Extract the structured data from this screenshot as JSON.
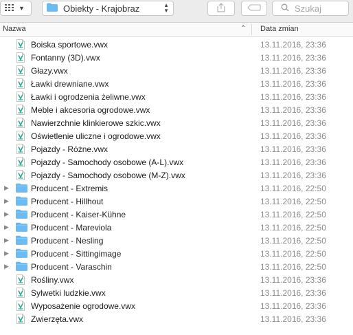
{
  "toolbar": {
    "path_label": "Obiekty - Krajobraz",
    "search_placeholder": "Szukaj"
  },
  "header": {
    "name_label": "Nazwa",
    "date_label": "Data zmian"
  },
  "colors": {
    "folder": "#6cbcf2",
    "file_icon": "#2aa892"
  },
  "rows": [
    {
      "name": "Boiska sportowe.vwx",
      "date": "13.11.2016, 23:36",
      "kind": "file"
    },
    {
      "name": "Fontanny (3D).vwx",
      "date": "13.11.2016, 23:36",
      "kind": "file"
    },
    {
      "name": "Głazy.vwx",
      "date": "13.11.2016, 23:36",
      "kind": "file"
    },
    {
      "name": "Ławki drewniane.vwx",
      "date": "13.11.2016, 23:36",
      "kind": "file"
    },
    {
      "name": "Ławki i ogrodzenia żeliwne.vwx",
      "date": "13.11.2016, 23:36",
      "kind": "file"
    },
    {
      "name": "Meble i akcesoria ogrodowe.vwx",
      "date": "13.11.2016, 23:36",
      "kind": "file"
    },
    {
      "name": "Nawierzchnie klinkierowe szkic.vwx",
      "date": "13.11.2016, 23:36",
      "kind": "file"
    },
    {
      "name": "Oświetlenie uliczne i ogrodowe.vwx",
      "date": "13.11.2016, 23:36",
      "kind": "file"
    },
    {
      "name": "Pojazdy - Różne.vwx",
      "date": "13.11.2016, 23:36",
      "kind": "file"
    },
    {
      "name": "Pojazdy - Samochody osobowe (A-L).vwx",
      "date": "13.11.2016, 23:36",
      "kind": "file"
    },
    {
      "name": "Pojazdy - Samochody osobowe (M-Z).vwx",
      "date": "13.11.2016, 23:36",
      "kind": "file"
    },
    {
      "name": "Producent - Extremis",
      "date": "13.11.2016, 22:50",
      "kind": "folder"
    },
    {
      "name": "Producent - Hillhout",
      "date": "13.11.2016, 22:50",
      "kind": "folder"
    },
    {
      "name": "Producent - Kaiser-Kühne",
      "date": "13.11.2016, 22:50",
      "kind": "folder"
    },
    {
      "name": "Producent - Mareviola",
      "date": "13.11.2016, 22:50",
      "kind": "folder"
    },
    {
      "name": "Producent - Nesling",
      "date": "13.11.2016, 22:50",
      "kind": "folder"
    },
    {
      "name": "Producent - Sittingimage",
      "date": "13.11.2016, 22:50",
      "kind": "folder"
    },
    {
      "name": "Producent - Varaschin",
      "date": "13.11.2016, 22:50",
      "kind": "folder"
    },
    {
      "name": "Rośliny.vwx",
      "date": "13.11.2016, 23:36",
      "kind": "file"
    },
    {
      "name": "Sylwetki ludzkie.vwx",
      "date": "13.11.2016, 23:36",
      "kind": "file"
    },
    {
      "name": "Wyposażenie ogrodowe.vwx",
      "date": "13.11.2016, 23:36",
      "kind": "file"
    },
    {
      "name": "Zwierzęta.vwx",
      "date": "13.11.2016, 23:36",
      "kind": "file"
    }
  ]
}
